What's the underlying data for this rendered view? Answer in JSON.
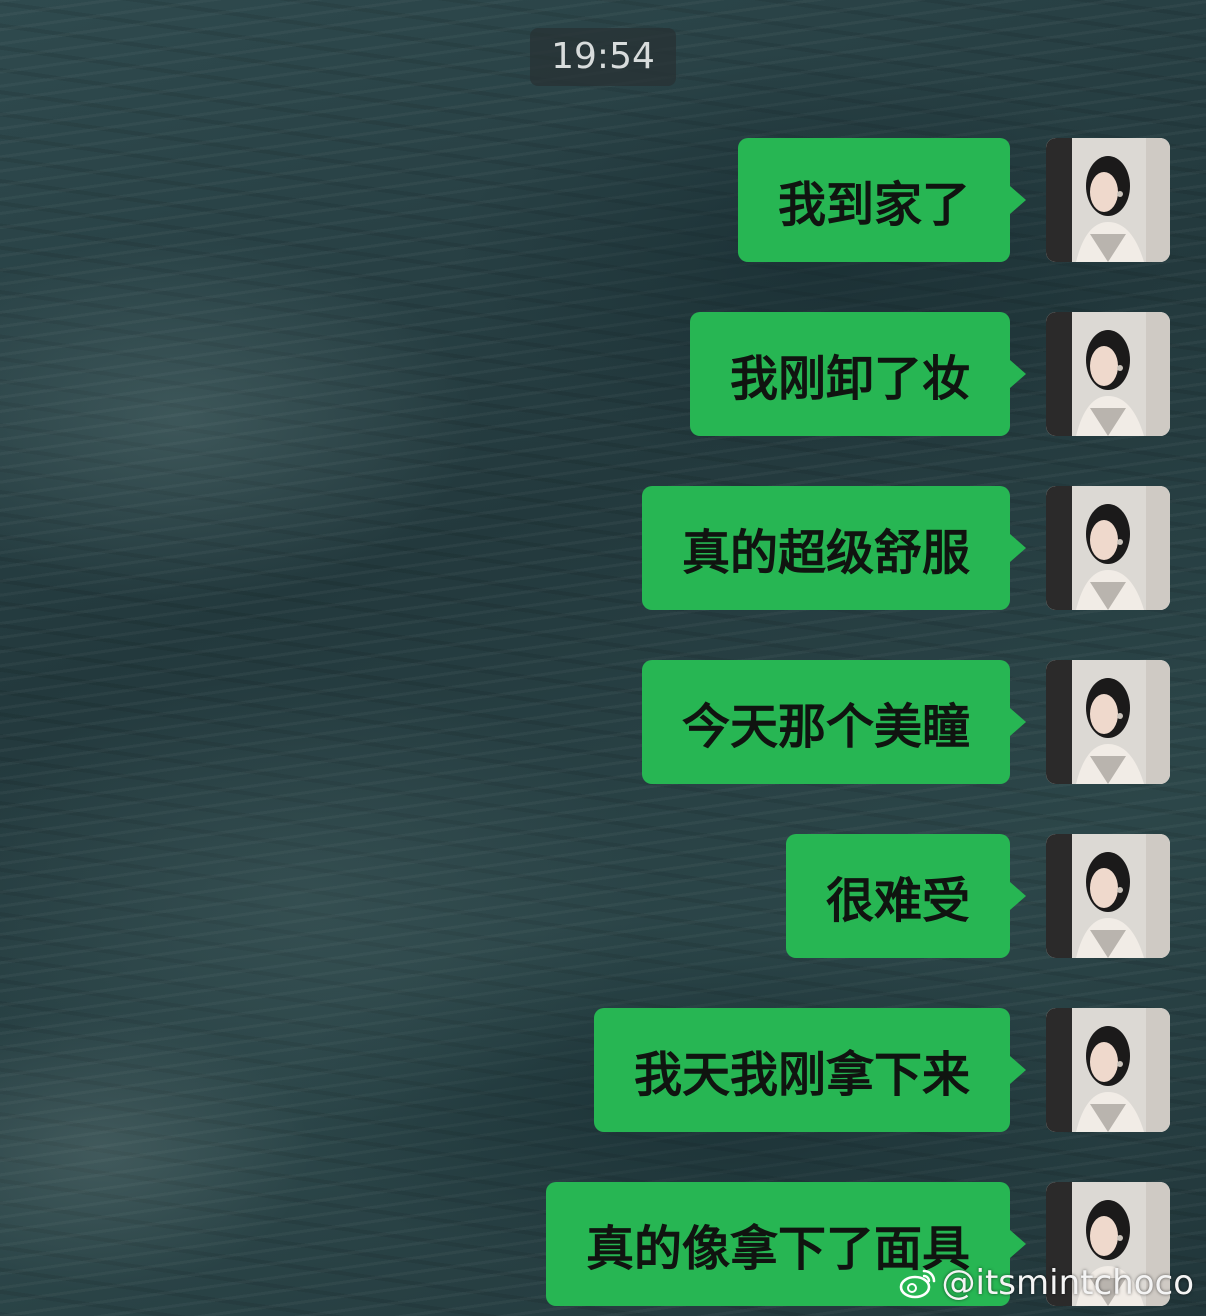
{
  "timestamp": "19:54",
  "messages": [
    {
      "text": "我到家了"
    },
    {
      "text": "我刚卸了妆"
    },
    {
      "text": "真的超级舒服"
    },
    {
      "text": "今天那个美瞳"
    },
    {
      "text": "很难受"
    },
    {
      "text": "我天我刚拿下来"
    },
    {
      "text": "真的像拿下了面具"
    }
  ],
  "watermark": {
    "handle": "@itsmintchoco",
    "icon": "weibo-logo-icon"
  },
  "colors": {
    "bubble": "#27b653",
    "text": "#101410",
    "background": "#2a4448"
  }
}
